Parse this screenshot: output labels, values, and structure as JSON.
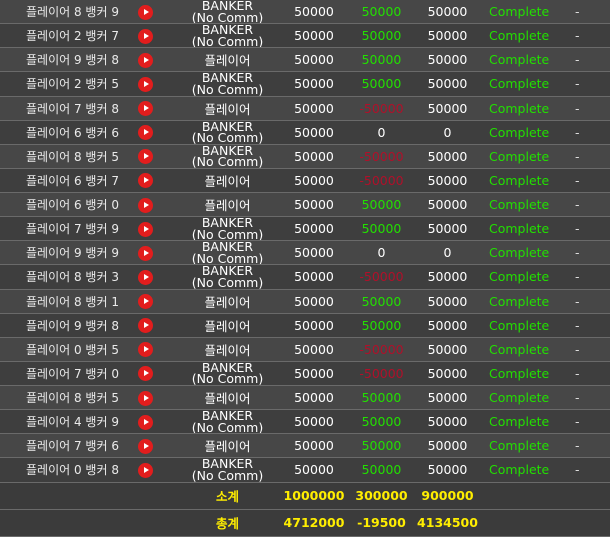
{
  "columns": [
    "result",
    "video",
    "bet",
    "amount",
    "win",
    "payout",
    "status",
    "action"
  ],
  "rows": [
    {
      "result": "플레이어 8 뱅커 9",
      "bet": [
        "BANKER",
        "(No Comm)"
      ],
      "amount": "50000",
      "win": "50000",
      "win_state": "win",
      "payout": "50000",
      "status": "Complete",
      "action": "-"
    },
    {
      "result": "플레이어 2 뱅커 7",
      "bet": [
        "BANKER",
        "(No Comm)"
      ],
      "amount": "50000",
      "win": "50000",
      "win_state": "win",
      "payout": "50000",
      "status": "Complete",
      "action": "-"
    },
    {
      "result": "플레이어 9 뱅커 8",
      "bet": [
        "플레이어"
      ],
      "amount": "50000",
      "win": "50000",
      "win_state": "win",
      "payout": "50000",
      "status": "Complete",
      "action": "-"
    },
    {
      "result": "플레이어 2 뱅커 5",
      "bet": [
        "BANKER",
        "(No Comm)"
      ],
      "amount": "50000",
      "win": "50000",
      "win_state": "win",
      "payout": "50000",
      "status": "Complete",
      "action": "-"
    },
    {
      "result": "플레이어 7 뱅커 8",
      "bet": [
        "플레이어"
      ],
      "amount": "50000",
      "win": "-50000",
      "win_state": "lose",
      "payout": "50000",
      "status": "Complete",
      "action": "-"
    },
    {
      "result": "플레이어 6 뱅커 6",
      "bet": [
        "BANKER",
        "(No Comm)"
      ],
      "amount": "50000",
      "win": "0",
      "win_state": "plain",
      "payout": "0",
      "status": "Complete",
      "action": "-"
    },
    {
      "result": "플레이어 8 뱅커 5",
      "bet": [
        "BANKER",
        "(No Comm)"
      ],
      "amount": "50000",
      "win": "-50000",
      "win_state": "lose",
      "payout": "50000",
      "status": "Complete",
      "action": "-"
    },
    {
      "result": "플레이어 6 뱅커 7",
      "bet": [
        "플레이어"
      ],
      "amount": "50000",
      "win": "-50000",
      "win_state": "lose",
      "payout": "50000",
      "status": "Complete",
      "action": "-"
    },
    {
      "result": "플레이어 6 뱅커 0",
      "bet": [
        "플레이어"
      ],
      "amount": "50000",
      "win": "50000",
      "win_state": "win",
      "payout": "50000",
      "status": "Complete",
      "action": "-"
    },
    {
      "result": "플레이어 7 뱅커 9",
      "bet": [
        "BANKER",
        "(No Comm)"
      ],
      "amount": "50000",
      "win": "50000",
      "win_state": "win",
      "payout": "50000",
      "status": "Complete",
      "action": "-"
    },
    {
      "result": "플레이어 9 뱅커 9",
      "bet": [
        "BANKER",
        "(No Comm)"
      ],
      "amount": "50000",
      "win": "0",
      "win_state": "plain",
      "payout": "0",
      "status": "Complete",
      "action": "-"
    },
    {
      "result": "플레이어 8 뱅커 3",
      "bet": [
        "BANKER",
        "(No Comm)"
      ],
      "amount": "50000",
      "win": "-50000",
      "win_state": "lose",
      "payout": "50000",
      "status": "Complete",
      "action": "-"
    },
    {
      "result": "플레이어 8 뱅커 1",
      "bet": [
        "플레이어"
      ],
      "amount": "50000",
      "win": "50000",
      "win_state": "win",
      "payout": "50000",
      "status": "Complete",
      "action": "-"
    },
    {
      "result": "플레이어 9 뱅커 8",
      "bet": [
        "플레이어"
      ],
      "amount": "50000",
      "win": "50000",
      "win_state": "win",
      "payout": "50000",
      "status": "Complete",
      "action": "-"
    },
    {
      "result": "플레이어 0 뱅커 5",
      "bet": [
        "플레이어"
      ],
      "amount": "50000",
      "win": "-50000",
      "win_state": "lose",
      "payout": "50000",
      "status": "Complete",
      "action": "-"
    },
    {
      "result": "플레이어 7 뱅커 0",
      "bet": [
        "BANKER",
        "(No Comm)"
      ],
      "amount": "50000",
      "win": "-50000",
      "win_state": "lose",
      "payout": "50000",
      "status": "Complete",
      "action": "-"
    },
    {
      "result": "플레이어 8 뱅커 5",
      "bet": [
        "플레이어"
      ],
      "amount": "50000",
      "win": "50000",
      "win_state": "win",
      "payout": "50000",
      "status": "Complete",
      "action": "-"
    },
    {
      "result": "플레이어 4 뱅커 9",
      "bet": [
        "BANKER",
        "(No Comm)"
      ],
      "amount": "50000",
      "win": "50000",
      "win_state": "win",
      "payout": "50000",
      "status": "Complete",
      "action": "-"
    },
    {
      "result": "플레이어 7 뱅커 6",
      "bet": [
        "플레이어"
      ],
      "amount": "50000",
      "win": "50000",
      "win_state": "win",
      "payout": "50000",
      "status": "Complete",
      "action": "-"
    },
    {
      "result": "플레이어 0 뱅커 8",
      "bet": [
        "BANKER",
        "(No Comm)"
      ],
      "amount": "50000",
      "win": "50000",
      "win_state": "win",
      "payout": "50000",
      "status": "Complete",
      "action": "-"
    }
  ],
  "subtotal": {
    "label": "소계",
    "amount": "1000000",
    "win": "300000",
    "payout": "900000"
  },
  "total": {
    "label": "총계",
    "amount": "4712000",
    "win": "-19500",
    "payout": "4134500"
  },
  "colors": {
    "win": "#22e000",
    "lose": "#b0102a",
    "totals": "#ffee00",
    "play_button": "#e21d1d"
  },
  "icons": {
    "video": "play-button-icon"
  }
}
